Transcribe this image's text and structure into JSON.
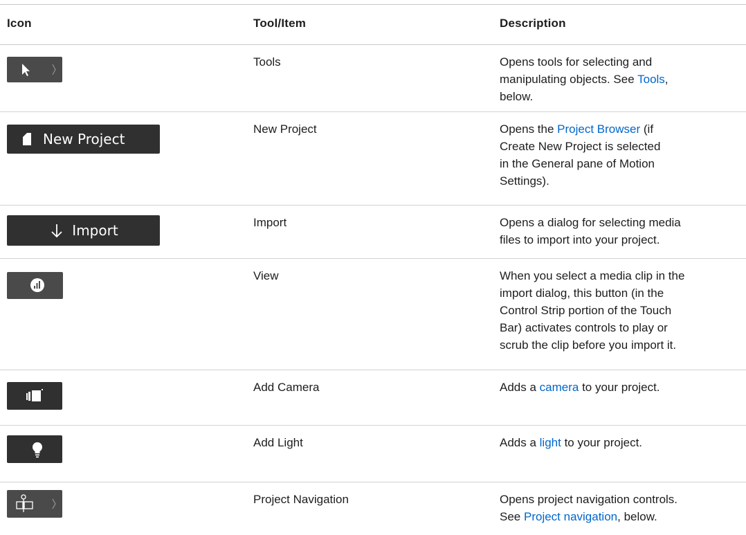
{
  "columns": {
    "icon": "Icon",
    "tool": "Tool/Item",
    "description": "Description"
  },
  "rows": [
    {
      "icon_name": "arrow-pointer-icon",
      "tool": "Tools",
      "desc": [
        [
          "Opens tools for selecting and"
        ],
        [
          "manipulating objects. See ",
          {
            "link": "Tools"
          },
          ","
        ],
        [
          "below."
        ]
      ]
    },
    {
      "icon_name": "document-icon",
      "icon_label": "New Project",
      "tool": "New Project",
      "desc": [
        [
          "Opens the ",
          {
            "link": "Project Browser"
          },
          " (if"
        ],
        [
          "Create New Project is selected"
        ],
        [
          "in the General pane of Motion"
        ],
        [
          "Settings)."
        ]
      ]
    },
    {
      "icon_name": "down-arrow-icon",
      "icon_label": "Import",
      "tool": "Import",
      "desc": [
        [
          "Opens a dialog for selecting media"
        ],
        [
          "files to import into your project."
        ]
      ]
    },
    {
      "icon_name": "audio-levels-icon",
      "tool": "View",
      "desc": [
        [
          "When you select a media clip in the"
        ],
        [
          "import dialog, this button (in the"
        ],
        [
          "Control Strip portion of the Touch"
        ],
        [
          "Bar) activates controls to play or"
        ],
        [
          "scrub the clip before you import it."
        ]
      ]
    },
    {
      "icon_name": "video-camera-icon",
      "tool": "Add Camera",
      "desc": [
        [
          "Adds a ",
          {
            "link": "camera"
          },
          " to your project."
        ]
      ]
    },
    {
      "icon_name": "lightbulb-icon",
      "tool": "Add Light",
      "desc": [
        [
          "Adds a ",
          {
            "link": "light"
          },
          " to your project."
        ]
      ]
    },
    {
      "icon_name": "project-navigation-icon",
      "tool": "Project Navigation",
      "desc": [
        [
          "Opens project navigation controls."
        ],
        [
          "See ",
          {
            "link": "Project navigation"
          },
          ", below."
        ]
      ]
    }
  ]
}
